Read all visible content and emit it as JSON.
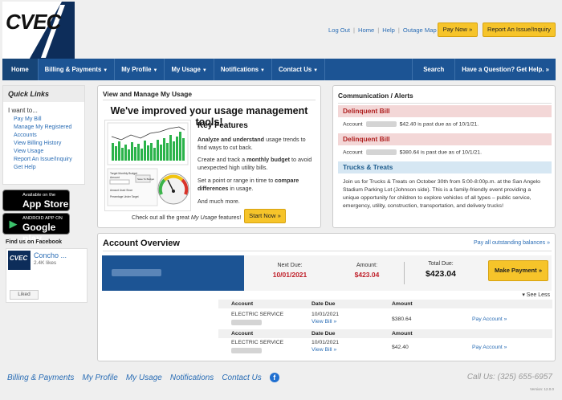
{
  "logo": {
    "text": "CVEC"
  },
  "toplinks": [
    {
      "label": "Log Out"
    },
    {
      "label": "Home"
    },
    {
      "label": "Help"
    },
    {
      "label": "Outage Map"
    }
  ],
  "header": {
    "pay_now": "Pay Now »",
    "report": "Report An Issue/Inquiry"
  },
  "nav": {
    "items": [
      "Home",
      "Billing & Payments",
      "My Profile",
      "My Usage",
      "Notifications",
      "Contact Us"
    ],
    "search": "Search",
    "help": "Have a Question? Get Help. »"
  },
  "quick_links": {
    "title": "Quick Links",
    "intro": "I want to...",
    "items": [
      "Pay My Bill",
      "Manage My Registered Accounts",
      "View Billing History",
      "View Usage",
      "Report An Issue/Inquiry",
      "Get Help"
    ]
  },
  "apps": {
    "appstore_small": "Available on the",
    "appstore_big": "App Store",
    "gplay_small": "ANDROID APP ON",
    "gplay_big": "Google play"
  },
  "facebook": {
    "title": "Find us on Facebook",
    "page_name": "Concho ...",
    "likes": "2.4K likes",
    "liked": "Liked",
    "thumb_text": "CVEC"
  },
  "usage": {
    "title": "View and Manage My Usage",
    "headline": "We've improved your usage management tools!",
    "key_features": "Key Features",
    "f1_bold": "Analyze and understand",
    "f1_rest": " usage trends to find ways to cut back.",
    "f2_pre": "Create and track a ",
    "f2_bold": "monthly budget",
    "f2_rest": " to avoid unexpected high utility bills.",
    "f3_pre": "Set a point or range in time to ",
    "f3_bold": "compare differences",
    "f3_rest": " in usage.",
    "f4": "And much more.",
    "checkout_pre": "Check out all the great ",
    "checkout_em": "My Usage",
    "checkout_post": " features!",
    "start_now": "Start Now »",
    "thumb_budget": "Target Monthly Budget",
    "thumb_amount": "Amount",
    "thumb_recent": "Amount Used Since",
    "thumb_pct": "Percentage Under Target",
    "thumb_save": "Save To Budget"
  },
  "alerts": {
    "title": "Communication / Alerts",
    "items": [
      {
        "heading": "Delinquent Bill",
        "label": "Account",
        "message": "$42.40 is past due as of 10/1/21."
      },
      {
        "heading": "Delinquent Bill",
        "label": "Account",
        "message": "$380.64 is past due as of 10/1/21."
      }
    ],
    "event_title": "Trucks & Treats",
    "event_text": "Join us for Trucks & Treats on October 30th from 5:00-8:00p.m. at the San Angelo Stadium Parking Lot (Johnson side). This is a family-friendly event providing a unique opportunity for children to explore vehicles of all types – public service, emergency, utility, construction, transportation, and delivery trucks!"
  },
  "account_overview": {
    "title": "Account Overview",
    "pay_all": "Pay all outstanding balances »",
    "next_due_label": "Next Due:",
    "next_due": "10/01/2021",
    "amount_label": "Amount:",
    "amount": "$423.04",
    "total_label": "Total Due:",
    "total": "$423.04",
    "make_payment": "Make Payment »",
    "see_less": "▾ See Less",
    "columns": [
      "Account",
      "Date Due",
      "Amount"
    ],
    "bills": [
      {
        "service": "ELECTRIC SERVICE",
        "date": "10/01/2021",
        "view": "View Bill »",
        "amount": "$380.64",
        "pay": "Pay Account »"
      },
      {
        "service": "ELECTRIC SERVICE",
        "date": "10/01/2021",
        "view": "View Bill »",
        "amount": "$42.40",
        "pay": "Pay Account »"
      }
    ]
  },
  "footer": {
    "links": [
      "Billing & Payments",
      "My Profile",
      "My Usage",
      "Notifications",
      "Contact Us"
    ],
    "call": "Call Us: (325) 655-6957",
    "version": "Version: 12.0.0"
  },
  "colors": {
    "nav": "#1c5494",
    "accent_yellow": "#f6c42a",
    "alert_red": "#b02222",
    "link": "#2a6db5"
  }
}
